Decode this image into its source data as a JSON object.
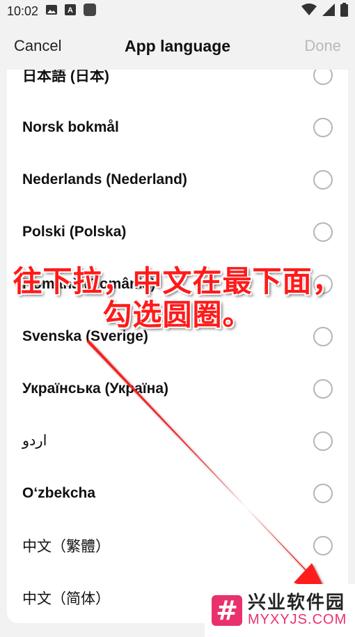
{
  "status_bar": {
    "time": "10:02",
    "icons": [
      "image-icon",
      "font-icon",
      "app-square-icon",
      "wifi-icon",
      "signal-icon",
      "battery-icon"
    ]
  },
  "nav": {
    "cancel_label": "Cancel",
    "title": "App language",
    "done_label": "Done"
  },
  "languages": [
    {
      "label": "日本語 (日本)",
      "selected": false
    },
    {
      "label": "Norsk bokmål",
      "selected": false
    },
    {
      "label": "Nederlands (Nederland)",
      "selected": false
    },
    {
      "label": "Polski (Polska)",
      "selected": false
    },
    {
      "label": "Română (România)",
      "selected": false
    },
    {
      "label": "Svenska (Sverige)",
      "selected": false
    },
    {
      "label": "Українська (Україна)",
      "selected": false
    },
    {
      "label": "اردو",
      "selected": false
    },
    {
      "label": "O‘zbekcha",
      "selected": false
    },
    {
      "label": "中文（繁體）",
      "selected": false
    },
    {
      "label": "中文（简体）",
      "selected": false
    }
  ],
  "annotation": {
    "line1": "往下拉，中文在最下面，",
    "line2": "勾选圆圈。",
    "color": "#ff1a1a"
  },
  "watermark": {
    "symbol": "#",
    "name_cn": "兴业软件园",
    "domain": "MYXYJS.COM"
  }
}
